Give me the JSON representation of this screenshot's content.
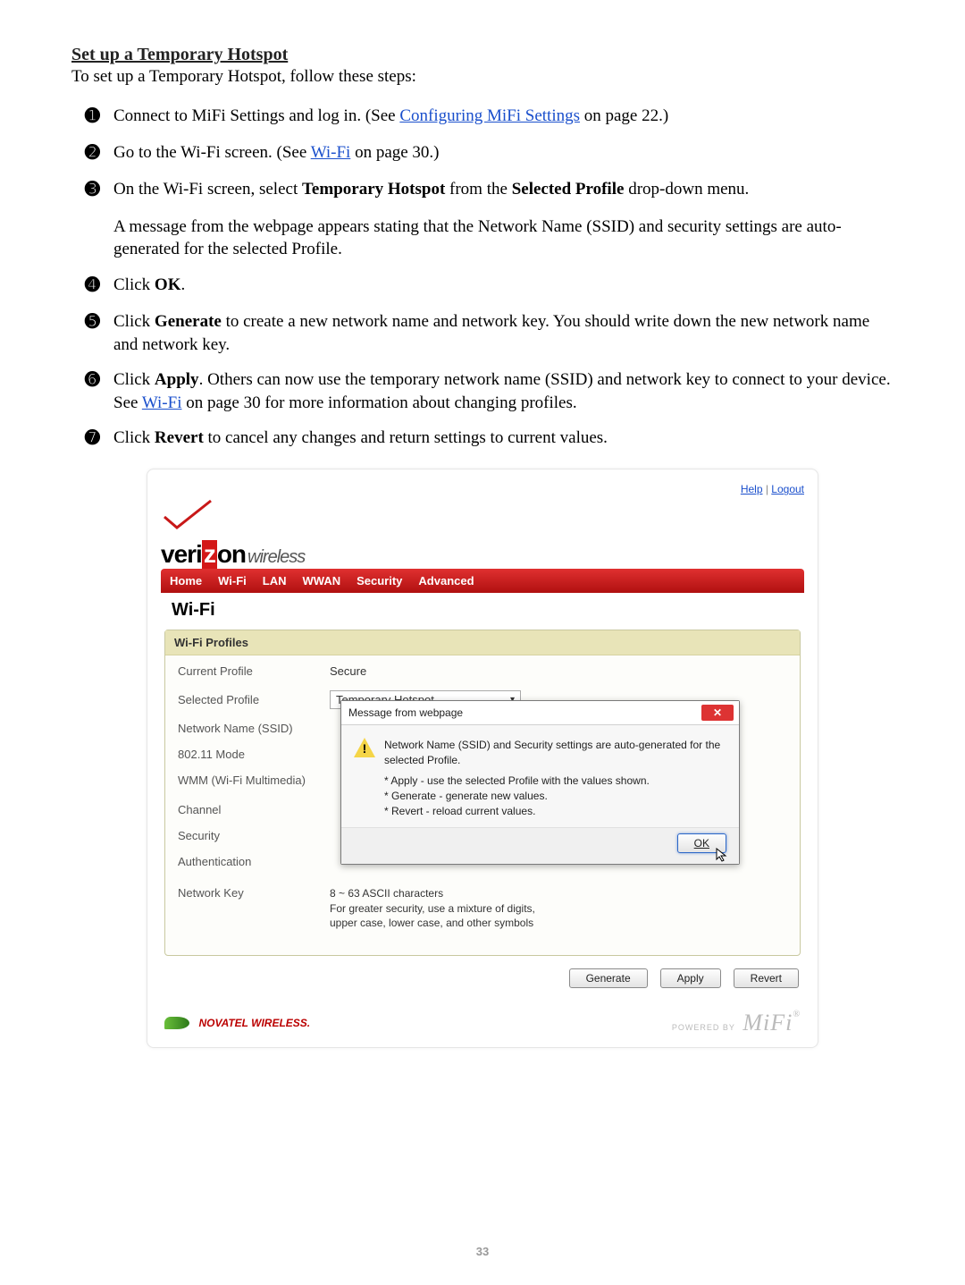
{
  "title": "Set up a Temporary Hotspot",
  "intro": "To set up a Temporary Hotspot, follow these steps:",
  "steps": {
    "s1a": "Connect to MiFi Settings and log in. (See ",
    "s1link": "Configuring MiFi Settings",
    "s1b": " on page 22.)",
    "s2a": "Go to the Wi-Fi screen. (See ",
    "s2link": "Wi-Fi",
    "s2b": " on page 30.)",
    "s3a": "On the Wi-Fi screen, select ",
    "s3b1": "Temporary Hotspot",
    "s3c": " from the ",
    "s3b2": "Selected Profile",
    "s3d": " drop-down menu.",
    "s3e": "A message from the webpage appears stating that the Network Name (SSID) and security settings are auto-generated for the selected Profile.",
    "s4a": "Click ",
    "s4b": "OK",
    "s4c": ".",
    "s5a": "Click ",
    "s5b": "Generate",
    "s5c": " to create a new network name and network key. You should write down the new network name and network key.",
    "s6a": "Click ",
    "s6b": "Apply",
    "s6c": ". Others can now use the temporary network name (SSID) and network key to connect to your device. See ",
    "s6link": "Wi-Fi",
    "s6d": " on page 30 for more information about changing profiles.",
    "s7a": "Click ",
    "s7b": "Revert",
    "s7c": " to cancel any changes and return settings to current values."
  },
  "numbers": {
    "n1": "➊",
    "n2": "➋",
    "n3": "➌",
    "n4": "➍",
    "n5": "➎",
    "n6": "➏",
    "n7": "➐"
  },
  "shot": {
    "help": "Help",
    "logout": "Logout",
    "logo1": "veri",
    "logo2": "z",
    "logo3": "on",
    "logo4": "wireless",
    "nav": {
      "home": "Home",
      "wifi": "Wi-Fi",
      "lan": "LAN",
      "wwan": "WWAN",
      "security": "Security",
      "advanced": "Advanced"
    },
    "h": "Wi-Fi",
    "panelTitle": "Wi-Fi Profiles",
    "rows": {
      "currentProfile": "Current Profile",
      "currentProfileVal": "Secure",
      "selectedProfile": "Selected Profile",
      "selectedProfileVal": "Temporary Hotspot",
      "ssid": "Network Name (SSID)",
      "mode": "802.11 Mode",
      "wmm": "WMM (Wi-Fi Multimedia)",
      "channel": "Channel",
      "security": "Security",
      "auth": "Authentication",
      "nk": "Network Key"
    },
    "nkHint1": "8 ~ 63 ASCII characters",
    "nkHint2": "For greater security, use a mixture of digits,",
    "nkHint3": "upper case, lower case, and other symbols",
    "dlgTitle": "Message from webpage",
    "dlgLine1": "Network Name (SSID) and Security settings are auto-generated for the selected Profile.",
    "dlgLine2": "* Apply - use the selected Profile with the values shown.",
    "dlgLine3": "* Generate - generate new values.",
    "dlgLine4": "* Revert - reload current values.",
    "ok": "OK",
    "generate": "Generate",
    "apply": "Apply",
    "revert": "Revert",
    "novatel": "NOVATEL WIRELESS.",
    "powered": "POWERED BY",
    "mifi": "MiFi"
  },
  "pageNumber": "33"
}
